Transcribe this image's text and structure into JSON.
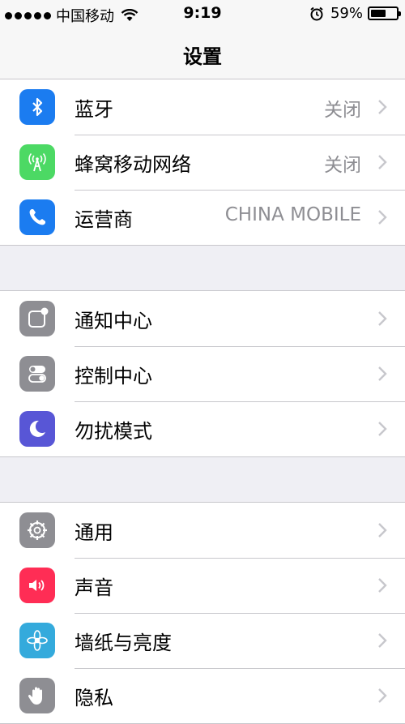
{
  "status_bar": {
    "carrier": "中国移动",
    "time": "9:19",
    "battery_percent": "59%",
    "battery_level": 0.59,
    "signal_icon": "signal-dots-icon",
    "wifi_icon": "wifi-icon",
    "alarm_icon": "alarm-icon"
  },
  "nav": {
    "title": "设置"
  },
  "groups": [
    {
      "rows": [
        {
          "label": "蓝牙",
          "value": "关闭",
          "icon": "bluetooth-icon",
          "color": "#1b7cf0"
        },
        {
          "label": "蜂窝移动网络",
          "value": "关闭",
          "icon": "cellular-icon",
          "color": "#4cd964"
        },
        {
          "label": "运营商",
          "value": "CHINA MOBILE",
          "icon": "phone-icon",
          "color": "#1b7cf0"
        }
      ]
    },
    {
      "rows": [
        {
          "label": "通知中心",
          "value": "",
          "icon": "notification-center-icon",
          "color": "#8e8e93"
        },
        {
          "label": "控制中心",
          "value": "",
          "icon": "control-center-icon",
          "color": "#8e8e93"
        },
        {
          "label": "勿扰模式",
          "value": "",
          "icon": "moon-icon",
          "color": "#5856d6"
        }
      ]
    },
    {
      "rows": [
        {
          "label": "通用",
          "value": "",
          "icon": "gear-icon",
          "color": "#8e8e93"
        },
        {
          "label": "声音",
          "value": "",
          "icon": "speaker-icon",
          "color": "#ff2d55"
        },
        {
          "label": "墙纸与亮度",
          "value": "",
          "icon": "flower-icon",
          "color": "#34aadc"
        },
        {
          "label": "隐私",
          "value": "",
          "icon": "hand-icon",
          "color": "#8e8e93"
        }
      ]
    }
  ]
}
